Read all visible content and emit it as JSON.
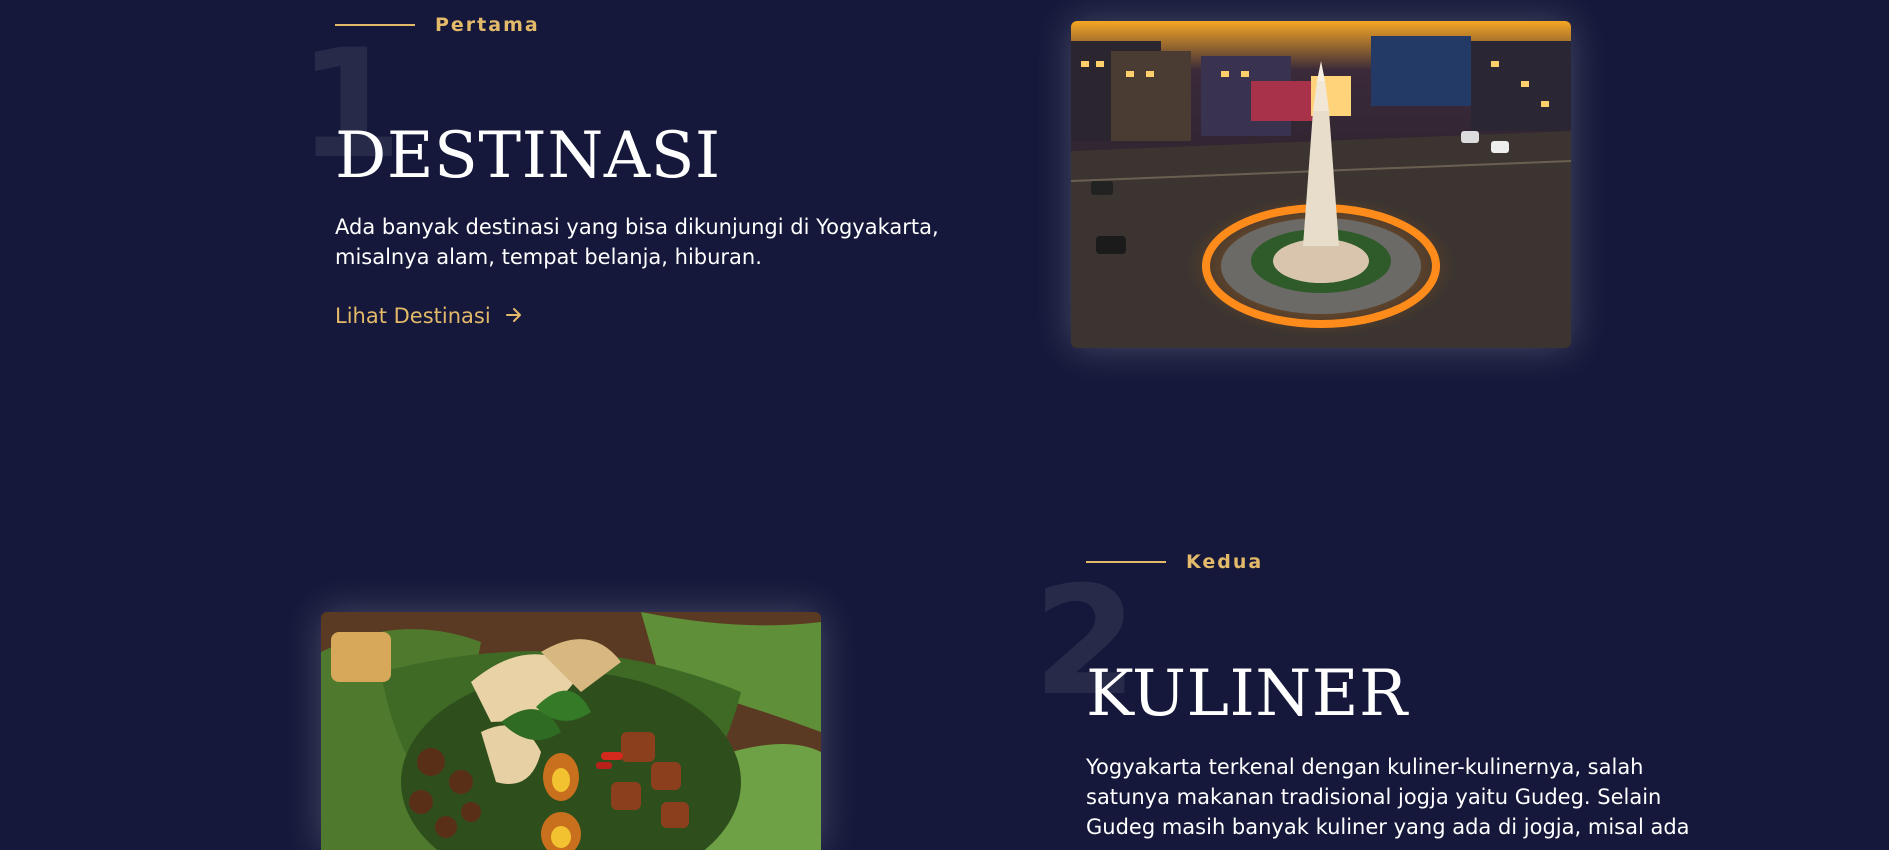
{
  "sections": [
    {
      "number": "1",
      "eyebrow": "Pertama",
      "title": "DESTINASI",
      "description_lines": [
        "Ada banyak destinasi yang bisa dikunjungi di Yogyakarta,",
        "misalnya alam, tempat belanja, hiburan."
      ],
      "link_label": "Lihat Destinasi",
      "link_icon": "arrow-right-icon",
      "image_subject": "tugu-yogyakarta-night-photo"
    },
    {
      "number": "2",
      "eyebrow": "Kedua",
      "title": "KULINER",
      "description_lines": [
        "Yogyakarta terkenal dengan kuliner-kulinernya, salah",
        "satunya makanan tradisional jogja yaitu Gudeg. Selain",
        "Gudeg masih banyak kuliner yang ada di jogja, misal ada"
      ],
      "image_subject": "gudeg-food-photo"
    }
  ],
  "colors": {
    "background": "#15183a",
    "accent": "#e3b96a",
    "text": "#ffffff"
  }
}
